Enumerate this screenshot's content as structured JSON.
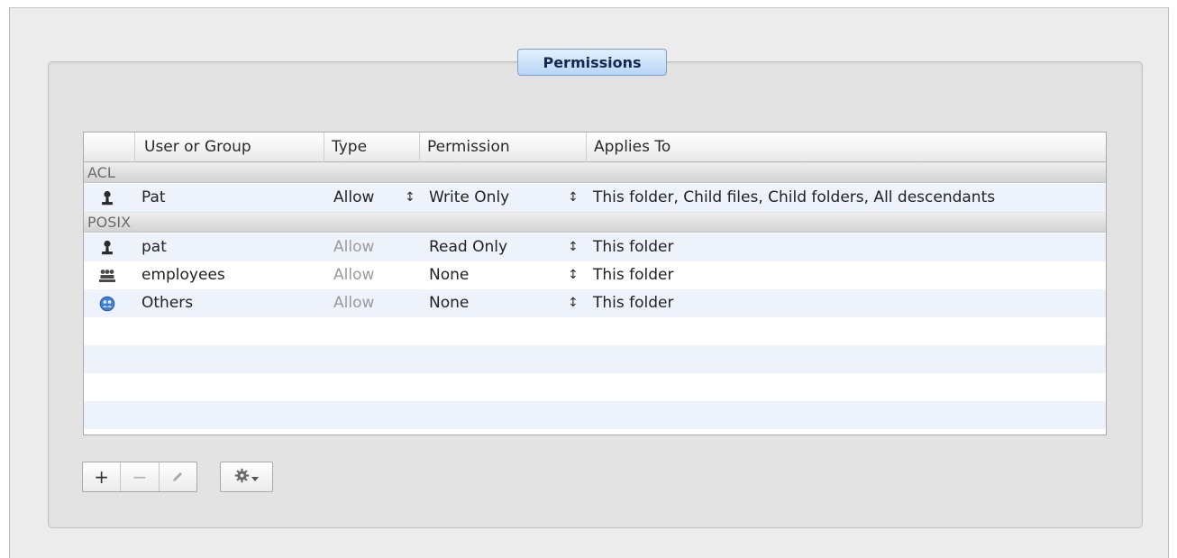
{
  "tab": {
    "label": "Permissions"
  },
  "table": {
    "columns": [
      "",
      "User or Group",
      "Type",
      "Permission",
      "Applies To"
    ],
    "sections": [
      {
        "label": "ACL",
        "rows": [
          {
            "icon": "single-user-icon",
            "name": "Pat",
            "type": "Allow",
            "permission": "Write Only",
            "applies_to": "This folder, Child files, Child folders, All descendants"
          }
        ]
      },
      {
        "label": "POSIX",
        "rows": [
          {
            "icon": "single-user-icon",
            "name": "pat",
            "type": "Allow",
            "permission": "Read Only",
            "applies_to": "This folder"
          },
          {
            "icon": "group-users-icon",
            "name": "employees",
            "type": "Allow",
            "permission": "None",
            "applies_to": "This folder"
          },
          {
            "icon": "everyone-globe-icon",
            "name": "Others",
            "type": "Allow",
            "permission": "None",
            "applies_to": "This folder"
          }
        ]
      }
    ]
  },
  "toolbar": {
    "add_label": "+",
    "remove_label": "−",
    "edit_icon": "pencil-icon",
    "action_icon": "gear-icon"
  },
  "colors": {
    "tab_fill": "#b8d5f6",
    "tab_text": "#15294f",
    "alt_row": "#eef3fb",
    "dim_text": "#9a9a9a"
  }
}
